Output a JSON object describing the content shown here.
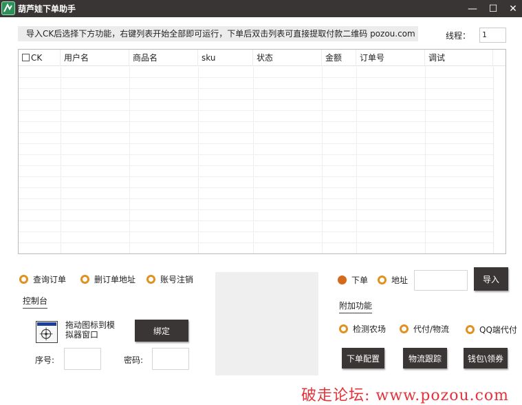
{
  "window": {
    "title": "葫芦娃下单助手",
    "min_glyph": "—",
    "max_glyph": "☐",
    "close_glyph": "✕"
  },
  "info": {
    "text": "导入CK后选择下方功能，右键列表开始全部即可运行，下单后双击列表可直接提取付款二维码 pozou.com",
    "thread_label": "线程：",
    "thread_value": "1"
  },
  "table": {
    "columns": [
      "CK",
      "用户名",
      "商品名",
      "sku",
      "状态",
      "金额",
      "订单号",
      "调试"
    ],
    "rows": []
  },
  "left_options": [
    {
      "label": "查询订单",
      "checked": false
    },
    {
      "label": "删订单地址",
      "checked": false
    },
    {
      "label": "账号注销",
      "checked": false
    }
  ],
  "console": {
    "section_label": "控制台",
    "drag_text": "拖动图标到模拟器窗口",
    "bind_button": "绑定",
    "serial_label": "序号:",
    "serial_value": "",
    "password_label": "密码:",
    "password_value": ""
  },
  "right_options": [
    {
      "label": "下单",
      "checked": true
    },
    {
      "label": "地址",
      "checked": false
    }
  ],
  "right_input_value": "",
  "import_button": "导入",
  "extra": {
    "section_label": "附加功能",
    "options": [
      {
        "label": "检测农场",
        "checked": false
      },
      {
        "label": "代付/物流",
        "checked": false
      },
      {
        "label": "QQ端代付",
        "checked": false
      }
    ],
    "buttons": [
      "下单配置",
      "物流跟踪",
      "钱包\\领券"
    ]
  },
  "watermark": "破走论坛: www.pozou.com",
  "colors": {
    "titlebar": "#3a3535",
    "button_dark": "#3b3636",
    "radio_accent": "#e2901f",
    "radio_checked": "#d46a1a",
    "watermark": "#e6323a"
  },
  "icons": [
    "app-logo-icon",
    "minimize-icon",
    "maximize-icon",
    "close-icon",
    "drag-target-icon"
  ]
}
